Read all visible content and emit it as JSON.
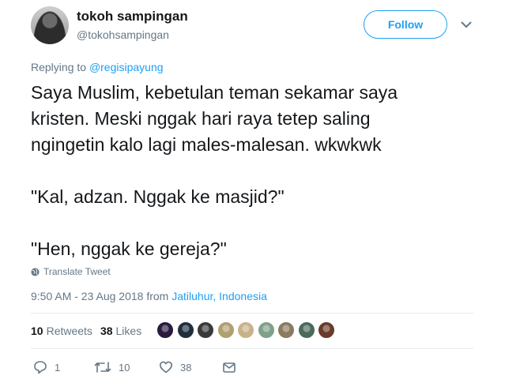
{
  "user": {
    "name": "tokoh sampingan",
    "handle": "@tokohsampingan"
  },
  "follow_label": "Follow",
  "reply_context": {
    "prefix": "Replying to",
    "mention": "@regisipayung"
  },
  "tweet_lines": [
    "Saya Muslim, kebetulan teman sekamar saya",
    "kristen. Meski nggak hari raya tetep saling",
    "ngingetin kalo lagi males-malesan. wkwkwk",
    "",
    "\"Kal, adzan. Nggak ke masjid?\"",
    "",
    "\"Hen, nggak ke gereja?\""
  ],
  "translate_label": "Translate Tweet",
  "timestamp": {
    "time_date": "9:50 AM - 23 Aug 2018 from",
    "location": "Jatiluhur, Indonesia"
  },
  "stats": {
    "retweets_count": "10",
    "retweets_label": "Retweets",
    "likes_count": "38",
    "likes_label": "Likes"
  },
  "liker_avatars": [
    {
      "color": "#2a1a3e",
      "icon": "avatar"
    },
    {
      "color": "#1f2f3f",
      "icon": "avatar"
    },
    {
      "color": "#3a3a3a",
      "icon": "avatar"
    },
    {
      "color": "#b0a070",
      "icon": "avatar"
    },
    {
      "color": "#c9b28a",
      "icon": "avatar"
    },
    {
      "color": "#7fa08a",
      "icon": "avatar"
    },
    {
      "color": "#8a7a60",
      "icon": "avatar"
    },
    {
      "color": "#4a6a5a",
      "icon": "avatar"
    },
    {
      "color": "#6a3a2a",
      "icon": "avatar"
    }
  ],
  "actions": {
    "reply_count": "1",
    "retweet_count": "10",
    "like_count": "38"
  },
  "colors": {
    "accent": "#1da1f2",
    "muted": "#657786",
    "text": "#14171a"
  }
}
